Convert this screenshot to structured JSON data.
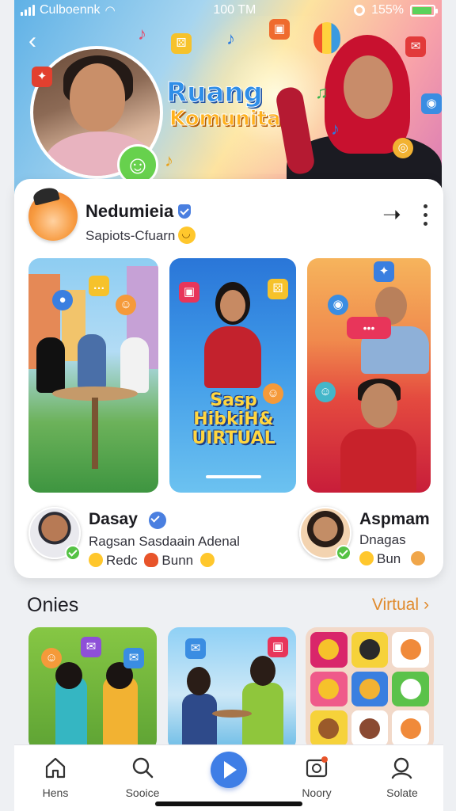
{
  "status_bar": {
    "carrier": "Culboennk",
    "time": "100 TM",
    "battery": "155%"
  },
  "hero": {
    "title_line1": "Ruang",
    "title_line2": "Komunitas"
  },
  "profile": {
    "name": "Nedumieia",
    "subtitle": "Sapiots-Cfuarn"
  },
  "feature_tiles": {
    "middle_text": "Sasp HibkiH& UIRTUAL"
  },
  "people": [
    {
      "name": "Dasay",
      "line1": "Ragsan Sasdaain Adenal",
      "line2": "Redc",
      "line2b": "Bunn"
    },
    {
      "name": "Aspmam",
      "line1": "Dnagas",
      "line2": "Bun"
    }
  ],
  "section": {
    "title": "Onies",
    "link": "Virtual",
    "link_arrow": "›"
  },
  "nav": {
    "items": [
      {
        "label": "Hens",
        "icon": "home-icon"
      },
      {
        "label": "Sooice",
        "icon": "search-icon"
      },
      {
        "label": "",
        "icon": "play-icon"
      },
      {
        "label": "Noory",
        "icon": "notification-icon"
      },
      {
        "label": "Solate",
        "icon": "profile-icon"
      }
    ]
  },
  "colors": {
    "accent_blue": "#3f7ee6",
    "link_orange": "#e08a2c",
    "verified_green": "#55c245"
  }
}
